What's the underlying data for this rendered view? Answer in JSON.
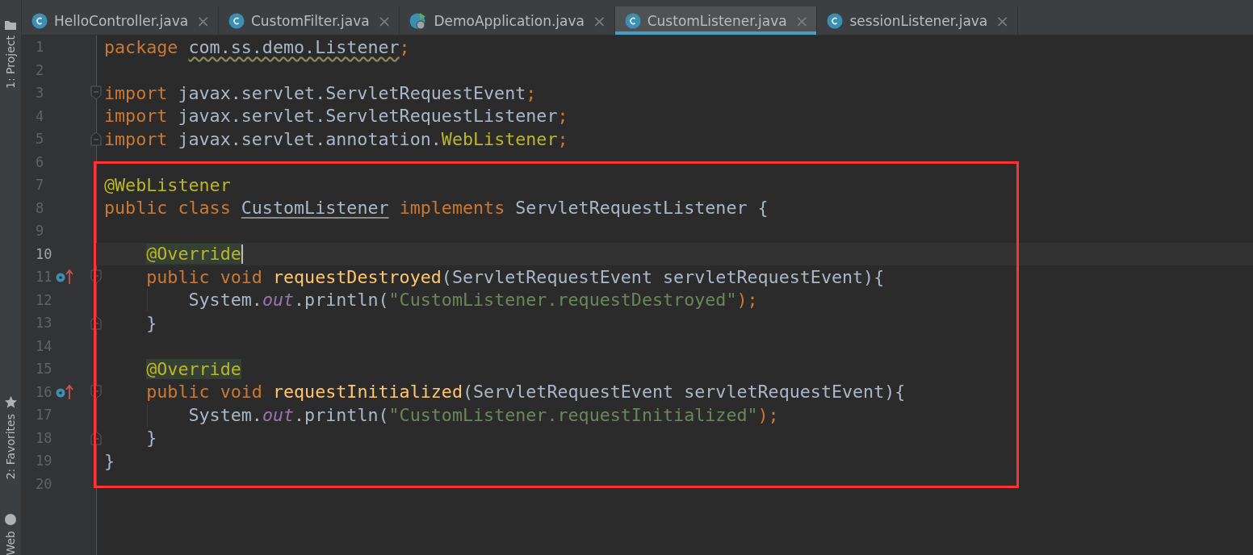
{
  "side_panels": [
    {
      "label": "1: Project"
    },
    {
      "label": "2: Favorites"
    },
    {
      "label": "Web"
    }
  ],
  "tabs": [
    {
      "label": "HelloController.java",
      "kind": "class",
      "close": "×",
      "selected": false
    },
    {
      "label": "CustomFilter.java",
      "kind": "class",
      "close": "×",
      "selected": false
    },
    {
      "label": "DemoApplication.java",
      "kind": "runnable",
      "close": "×",
      "selected": false
    },
    {
      "label": "CustomListener.java",
      "kind": "class",
      "close": "×",
      "selected": true
    },
    {
      "label": "sessionListener.java",
      "kind": "class",
      "close": "×",
      "selected": false
    }
  ],
  "lines": [
    {
      "number": "1",
      "current": false,
      "tokens": [
        {
          "text": "package ",
          "kind": "kw"
        },
        {
          "text": "com.ss.demo.Listener",
          "kind": "warn"
        },
        {
          "text": ";",
          "kind": "kw"
        }
      ]
    },
    {
      "number": "2",
      "current": false
    },
    {
      "number": "3",
      "current": false,
      "fold_open": true,
      "tokens": [
        {
          "text": "import ",
          "kind": "kw"
        },
        {
          "text": "javax.servlet.ServletRequestEvent",
          "kind": "plain"
        },
        {
          "text": ";",
          "kind": "kw"
        }
      ]
    },
    {
      "number": "4",
      "current": false,
      "tokens": [
        {
          "text": "import ",
          "kind": "kw"
        },
        {
          "text": "javax.servlet.ServletRequestListener",
          "kind": "plain"
        },
        {
          "text": ";",
          "kind": "kw"
        }
      ]
    },
    {
      "number": "5",
      "current": false,
      "fold_close": true,
      "tokens": [
        {
          "text": "import ",
          "kind": "kw"
        },
        {
          "text": "javax.servlet.annotation.",
          "kind": "plain"
        },
        {
          "text": "WebListener",
          "kind": "ann"
        },
        {
          "text": ";",
          "kind": "kw"
        }
      ]
    },
    {
      "number": "6",
      "current": false
    },
    {
      "number": "7",
      "current": false,
      "tokens": [
        {
          "text": "@WebListener",
          "kind": "ann"
        }
      ]
    },
    {
      "number": "8",
      "current": false,
      "tokens": [
        {
          "text": "public class ",
          "kind": "kw"
        },
        {
          "text": "CustomListener",
          "kind": "decl"
        },
        {
          "text": " implements ",
          "kind": "kw"
        },
        {
          "text": "ServletRequestListener {",
          "kind": "plain"
        }
      ]
    },
    {
      "number": "9",
      "current": false
    },
    {
      "number": "10",
      "current": true,
      "tokens": [
        {
          "text": "    @Override",
          "kind": "annhl"
        }
      ]
    },
    {
      "number": "11",
      "current": false,
      "overrides": true,
      "fold_open": true,
      "tokens": [
        {
          "text": "    public void ",
          "kind": "kw"
        },
        {
          "text": "requestDestroyed",
          "kind": "method"
        },
        {
          "text": "(ServletRequestEvent servletRequestEvent){",
          "kind": "plain"
        }
      ]
    },
    {
      "number": "12",
      "current": false,
      "tokens": [
        {
          "text": "        System.",
          "kind": "plain"
        },
        {
          "text": "out",
          "kind": "field"
        },
        {
          "text": ".println(",
          "kind": "plain"
        },
        {
          "text": "\"CustomListener.requestDestroyed\"",
          "kind": "str"
        },
        {
          "text": ");",
          "kind": "kw"
        }
      ]
    },
    {
      "number": "13",
      "current": false,
      "fold_close": true,
      "tokens": [
        {
          "text": "    }",
          "kind": "plain"
        }
      ]
    },
    {
      "number": "14",
      "current": false
    },
    {
      "number": "15",
      "current": false,
      "tokens": [
        {
          "text": "    @Override",
          "kind": "annhl"
        }
      ]
    },
    {
      "number": "16",
      "current": false,
      "overrides": true,
      "fold_open": true,
      "tokens": [
        {
          "text": "    public void ",
          "kind": "kw"
        },
        {
          "text": "requestInitialized",
          "kind": "method"
        },
        {
          "text": "(ServletRequestEvent servletRequestEvent){",
          "kind": "plain"
        }
      ]
    },
    {
      "number": "17",
      "current": false,
      "tokens": [
        {
          "text": "        System.",
          "kind": "plain"
        },
        {
          "text": "out",
          "kind": "field"
        },
        {
          "text": ".println(",
          "kind": "plain"
        },
        {
          "text": "\"CustomListener.requestInitialized\"",
          "kind": "str"
        },
        {
          "text": ");",
          "kind": "kw"
        }
      ]
    },
    {
      "number": "18",
      "current": false,
      "fold_close": true,
      "tokens": [
        {
          "text": "    }",
          "kind": "plain"
        }
      ]
    },
    {
      "number": "19",
      "current": false,
      "tokens": [
        {
          "text": "}",
          "kind": "plain"
        }
      ]
    },
    {
      "number": "20",
      "current": false
    }
  ]
}
